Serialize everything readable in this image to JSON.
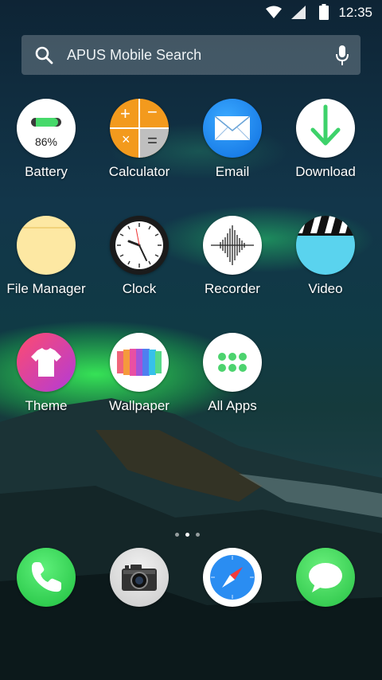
{
  "status_bar": {
    "time": "12:35"
  },
  "search": {
    "placeholder": "APUS Mobile Search"
  },
  "apps": [
    {
      "label": "Battery",
      "icon": "battery-icon",
      "value": "86%",
      "battery_level": 0.86
    },
    {
      "label": "Calculator",
      "icon": "calculator-icon"
    },
    {
      "label": "Email",
      "icon": "email-icon"
    },
    {
      "label": "Download",
      "icon": "download-icon"
    },
    {
      "label": "File Manager",
      "icon": "folder-icon"
    },
    {
      "label": "Clock",
      "icon": "clock-icon"
    },
    {
      "label": "Recorder",
      "icon": "recorder-icon"
    },
    {
      "label": "Video",
      "icon": "video-icon"
    },
    {
      "label": "Theme",
      "icon": "theme-icon"
    },
    {
      "label": "Wallpaper",
      "icon": "wallpaper-icon"
    },
    {
      "label": "All Apps",
      "icon": "all-apps-icon"
    }
  ],
  "dock": [
    {
      "icon": "phone-icon"
    },
    {
      "icon": "camera-icon"
    },
    {
      "icon": "browser-icon"
    },
    {
      "icon": "messages-icon"
    }
  ],
  "page_indicator": {
    "pages": 3,
    "current": 2
  }
}
